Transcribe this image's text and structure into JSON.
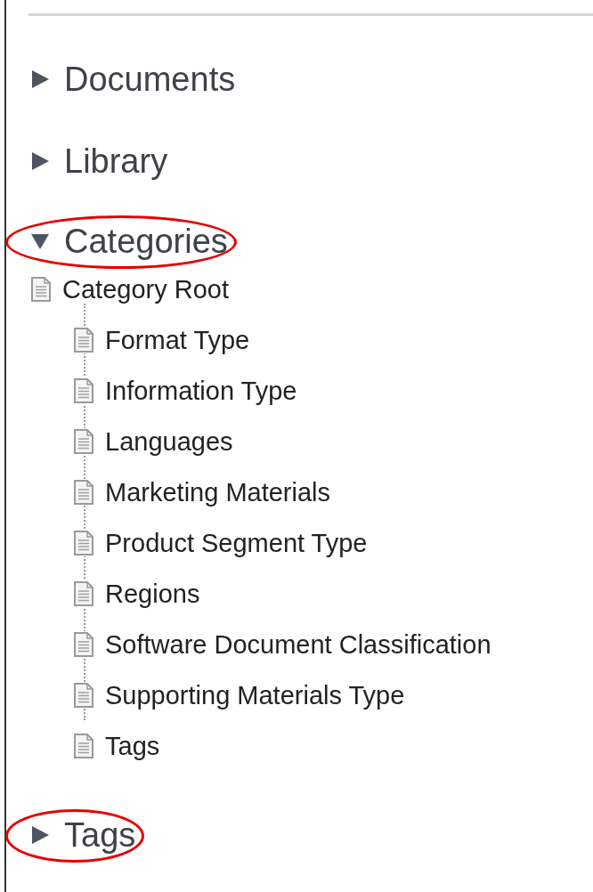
{
  "sections": [
    {
      "label": "Documents",
      "expanded": false,
      "highlighted": false
    },
    {
      "label": "Library",
      "expanded": false,
      "highlighted": false
    },
    {
      "label": "Categories",
      "expanded": true,
      "highlighted": true,
      "tree": {
        "label": "Category Root",
        "children": [
          {
            "label": "Format Type"
          },
          {
            "label": "Information Type"
          },
          {
            "label": "Languages"
          },
          {
            "label": "Marketing Materials"
          },
          {
            "label": "Product Segment Type"
          },
          {
            "label": "Regions"
          },
          {
            "label": "Software Document Classification"
          },
          {
            "label": "Supporting Materials Type"
          },
          {
            "label": "Tags"
          }
        ]
      }
    },
    {
      "label": "Tags",
      "expanded": false,
      "highlighted": true
    }
  ]
}
